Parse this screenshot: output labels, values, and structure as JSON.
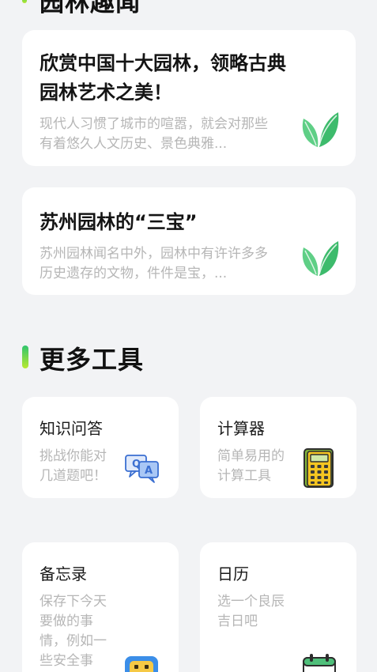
{
  "top_section": {
    "title": "园林趣闻"
  },
  "articles": [
    {
      "title": "欣赏中国十大园林，领略古典园林艺术之美！",
      "excerpt": "现代人习惯了城市的喧嚣，就会对那些有着悠久人文历史、景色典雅...",
      "icon": "leaf-icon"
    },
    {
      "title": "苏州园林的“三宝”",
      "excerpt": "苏州园林闻名中外，园林中有许许多多历史遗存的文物，件件是宝，...",
      "icon": "leaf-icon"
    }
  ],
  "tools_section": {
    "title": "更多工具"
  },
  "tools": [
    {
      "name": "知识问答",
      "desc": "挑战你能对几道题吧！",
      "icon": "qa-chat-icon"
    },
    {
      "name": "计算器",
      "desc": "简单易用的计算工具",
      "icon": "calculator-icon"
    },
    {
      "name": "备忘录",
      "desc": "保存下今天要做的事情，例如一些安全事",
      "icon": "memo-robot-icon"
    },
    {
      "name": "日历",
      "desc": "选一个良辰吉日吧",
      "icon": "calendar-icon"
    }
  ],
  "colors": {
    "background": "#f2f3f5",
    "card": "#ffffff",
    "accent_green": "#37c56a",
    "accent_lime": "#b9e930",
    "muted_text": "#b6b6b6"
  }
}
